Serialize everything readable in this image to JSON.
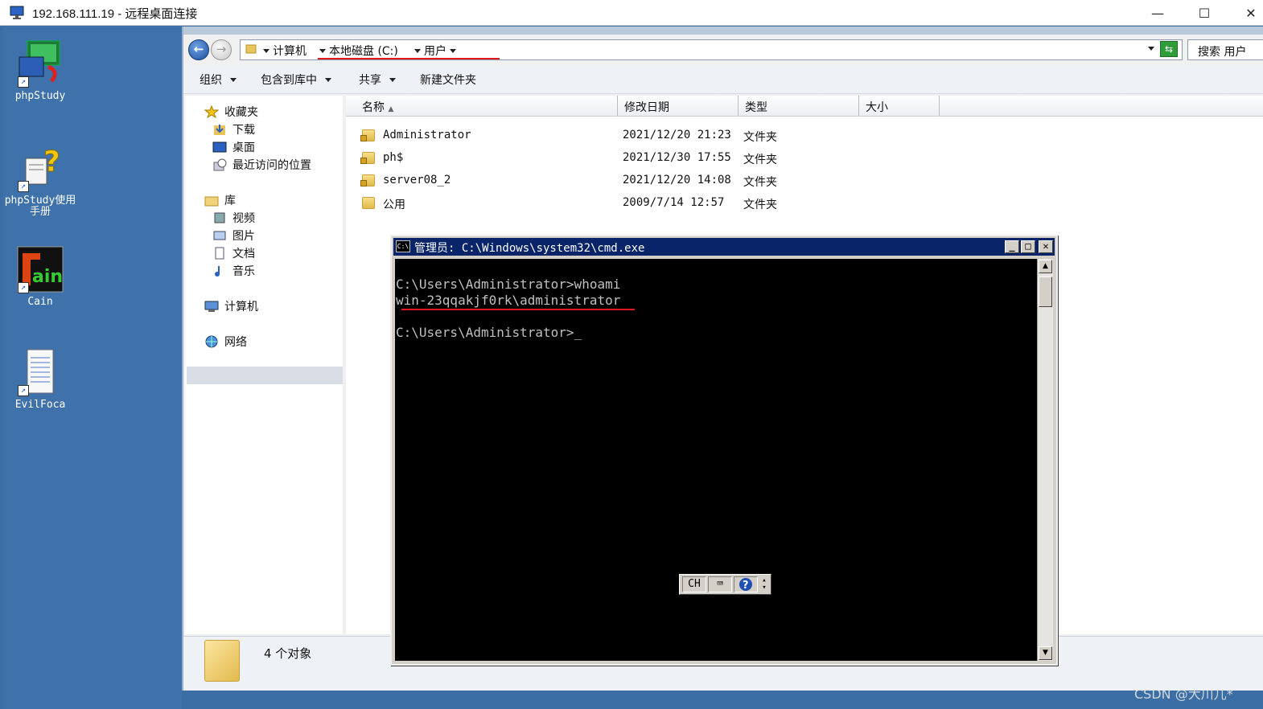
{
  "window": {
    "title": "192.168.111.19 - 远程桌面连接",
    "min": "—",
    "max": "☐",
    "close": "✕"
  },
  "desktop_icons": [
    {
      "label": "phpStudy"
    },
    {
      "label": "phpStudy使用手册"
    },
    {
      "label": "Cain"
    },
    {
      "label": "EvilFoca"
    }
  ],
  "address": {
    "crumbs": [
      "计算机",
      "本地磁盘 (C:)",
      "用户"
    ],
    "search_placeholder": "搜索 用户"
  },
  "toolbar": {
    "organize": "组织",
    "include": "包含到库中",
    "share": "共享",
    "new_folder": "新建文件夹"
  },
  "nav": {
    "favorites": "收藏夹",
    "downloads": "下载",
    "desktop": "桌面",
    "recent": "最近访问的位置",
    "libraries": "库",
    "videos": "视频",
    "pictures": "图片",
    "documents": "文档",
    "music": "音乐",
    "computer": "计算机",
    "network": "网络"
  },
  "columns": {
    "name": "名称",
    "date": "修改日期",
    "type": "类型",
    "size": "大小"
  },
  "files": [
    {
      "name": "Administrator",
      "date": "2021/12/20 21:23",
      "type": "文件夹"
    },
    {
      "name": "ph$",
      "date": "2021/12/30 17:55",
      "type": "文件夹"
    },
    {
      "name": "server08_2",
      "date": "2021/12/20 14:08",
      "type": "文件夹"
    },
    {
      "name": "公用",
      "date": "2009/7/14 12:57",
      "type": "文件夹"
    }
  ],
  "status": {
    "count": "4 个对象"
  },
  "cmd": {
    "title": "管理员: C:\\Windows\\system32\\cmd.exe",
    "line1": "C:\\Users\\Administrator>whoami",
    "line2": "win-23qqakjf0rk\\administrator",
    "line3": "C:\\Users\\Administrator>_",
    "ime_lang": "CH"
  },
  "watermark": "CSDN @大川儿*"
}
